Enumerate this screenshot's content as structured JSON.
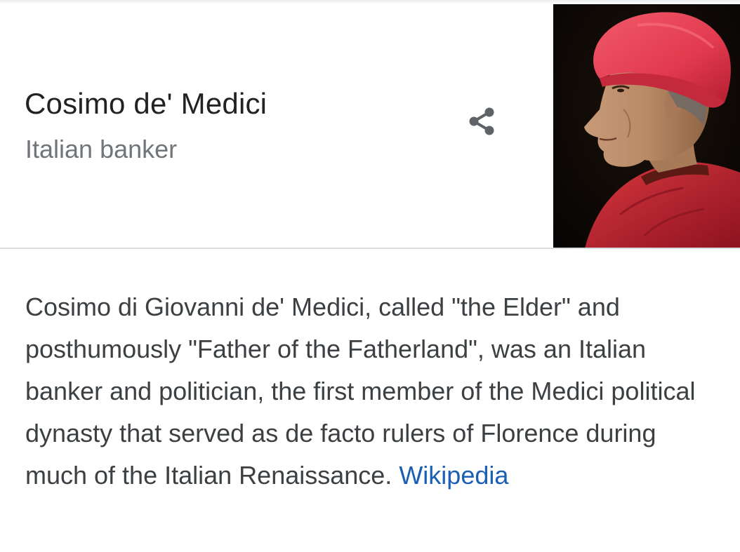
{
  "entity": {
    "title": "Cosimo de' Medici",
    "subtitle": "Italian banker"
  },
  "actions": {
    "share_icon": "share-icon"
  },
  "image": {
    "subject": "portrait-image"
  },
  "description": {
    "text": "Cosimo di Giovanni de' Medici, called \"the Elder\" and posthumously \"Father of the Fatherland\", was an Italian banker and politician, the first member of the Medici political dynasty that served as de facto rulers of Florence during much of the Italian Renaissance.",
    "source_label": "Wikipedia"
  },
  "colors": {
    "title": "#222222",
    "subtitle": "#70757a",
    "body_text": "#3c4043",
    "link": "#1a5fb4",
    "divider": "#dadce0",
    "icon": "#5f6368"
  }
}
